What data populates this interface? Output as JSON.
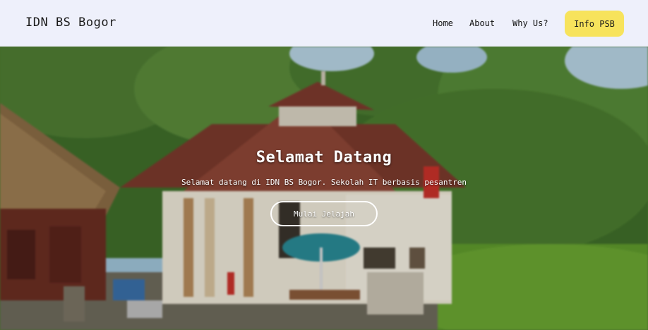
{
  "navbar": {
    "brand": "IDN BS Bogor",
    "links": [
      "Home",
      "About",
      "Why Us?"
    ],
    "cta_label": "Info PSB"
  },
  "hero": {
    "title": "Selamat Datang",
    "subtitle": "Selamat datang di IDN BS Bogor. Sekolah IT berbasis pesantren",
    "button_label": "Mulai Jelajah"
  },
  "colors": {
    "navbar_bg": "#eef0fb",
    "cta_bg": "#f7e35c",
    "hero_text": "#ffffff"
  }
}
